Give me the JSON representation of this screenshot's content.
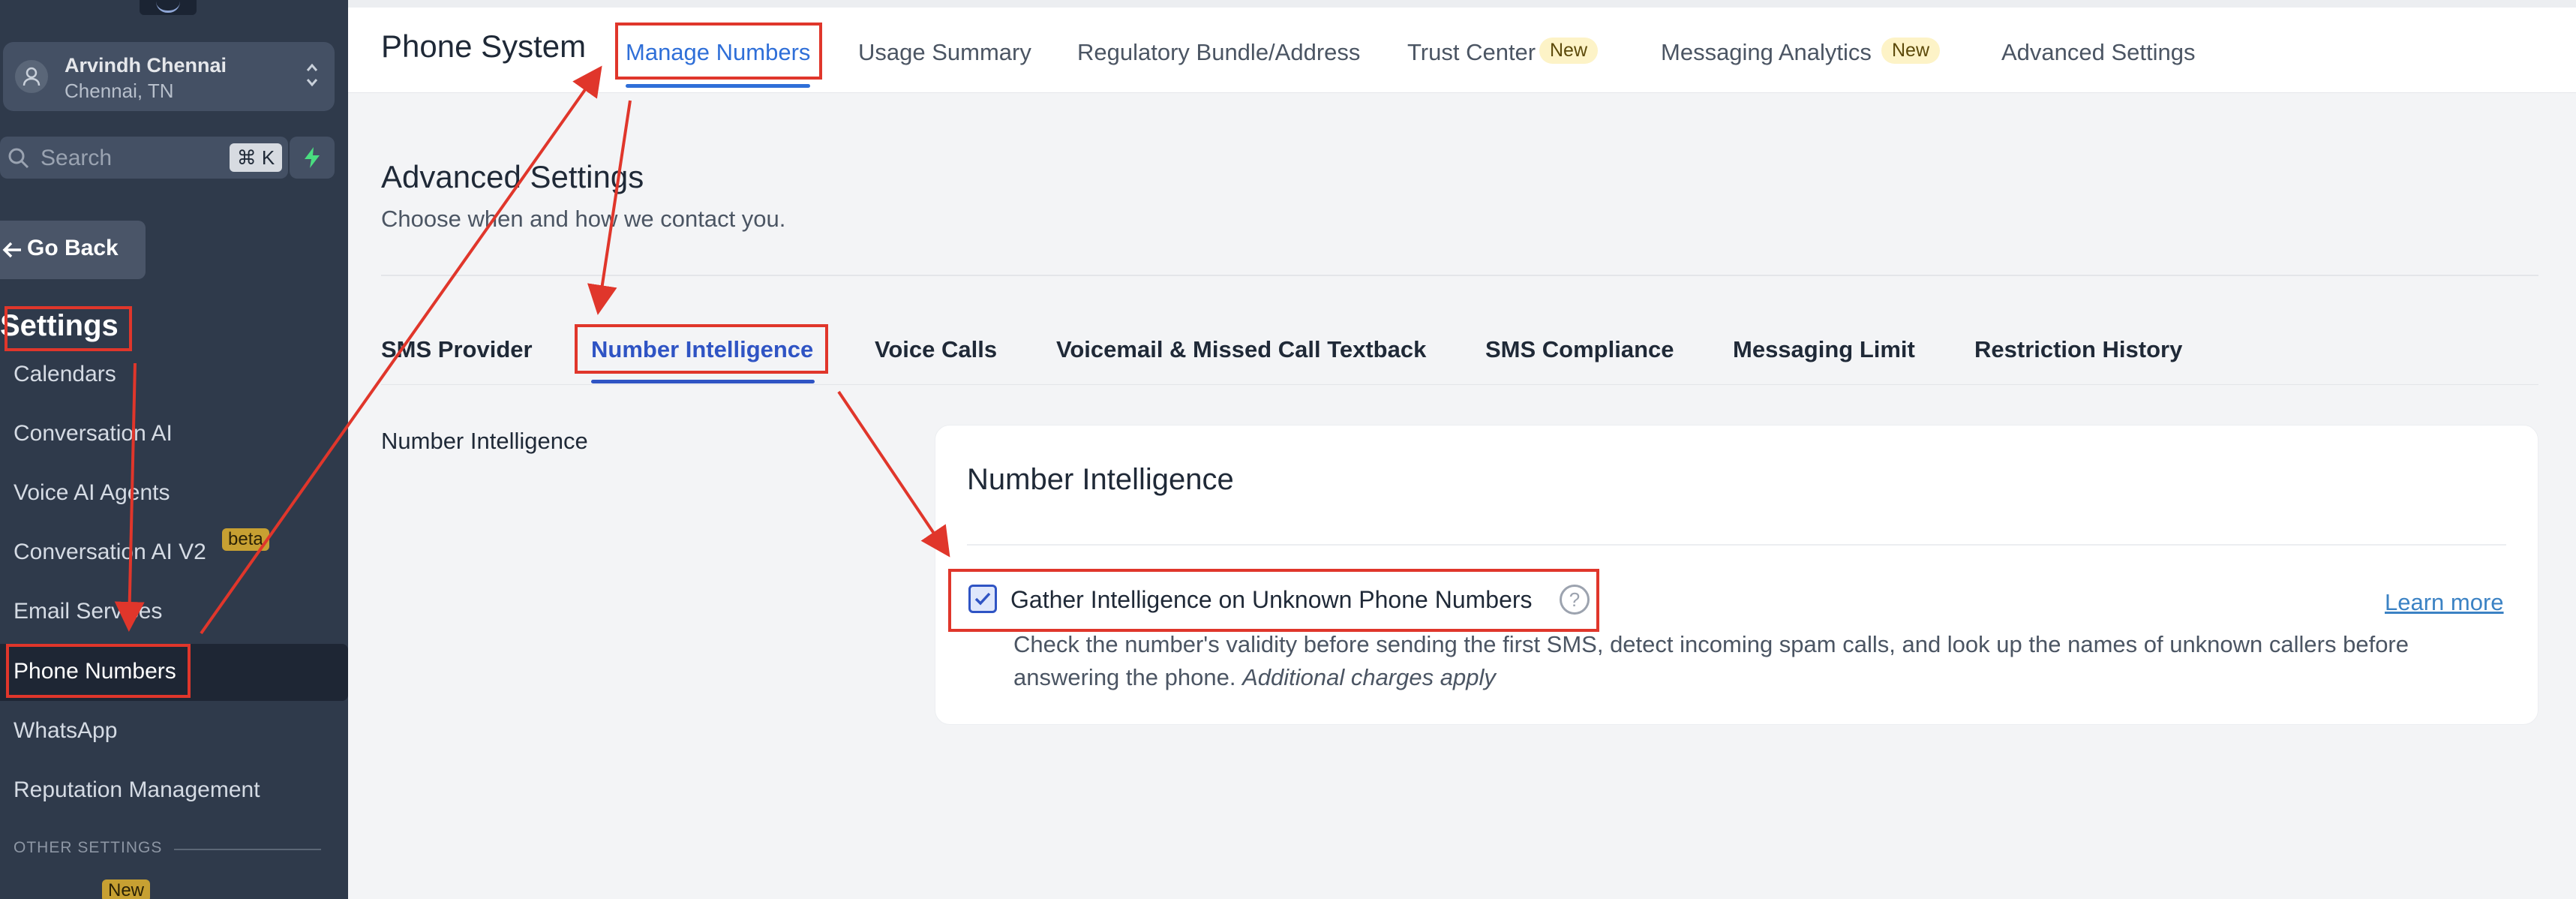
{
  "account": {
    "name": "Arvindh Chennai",
    "location": "Chennai, TN"
  },
  "search": {
    "placeholder": "Search",
    "shortcut": "⌘ K"
  },
  "sidebar": {
    "go_back": "Go Back",
    "heading": "Settings",
    "items": [
      {
        "label": "Calendars"
      },
      {
        "label": "Conversation AI"
      },
      {
        "label": "Voice AI Agents"
      },
      {
        "label": "Conversation AI V2",
        "badge": "beta"
      },
      {
        "label": "Email Services"
      },
      {
        "label": "Phone Numbers",
        "active": true
      },
      {
        "label": "WhatsApp"
      },
      {
        "label": "Reputation Management"
      }
    ],
    "other_settings": "OTHER SETTINGS",
    "next_badge": "New"
  },
  "header": {
    "title": "Phone System",
    "tabs": [
      {
        "label": "Manage Numbers",
        "active": true
      },
      {
        "label": "Usage Summary"
      },
      {
        "label": "Regulatory Bundle/Address"
      },
      {
        "label": "Trust Center",
        "badge": "New"
      },
      {
        "label": "Messaging Analytics",
        "badge": "New"
      },
      {
        "label": "Advanced Settings"
      }
    ]
  },
  "section": {
    "title": "Advanced Settings",
    "subtitle": "Choose when and how we contact you."
  },
  "subtabs": [
    {
      "label": "SMS Provider"
    },
    {
      "label": "Number Intelligence",
      "active": true
    },
    {
      "label": "Voice Calls"
    },
    {
      "label": "Voicemail & Missed Call Textback"
    },
    {
      "label": "SMS Compliance"
    },
    {
      "label": "Messaging Limit"
    },
    {
      "label": "Restriction History"
    }
  ],
  "panel": {
    "side_label": "Number Intelligence",
    "card_title": "Number Intelligence",
    "option_label": "Gather Intelligence on Unknown Phone Numbers",
    "option_checked": true,
    "help": "?",
    "learn_more": "Learn more",
    "description": "Check the number's validity before sending the first SMS, detect incoming spam calls, and look up the names of unknown callers before answering the phone.",
    "description_note": "Additional charges apply"
  },
  "colors": {
    "sidebar_bg": "#2f3a4b",
    "accent_blue": "#2f6fd8",
    "annotation_red": "#e0362b",
    "badge_yellow": "#fdf3c7"
  }
}
